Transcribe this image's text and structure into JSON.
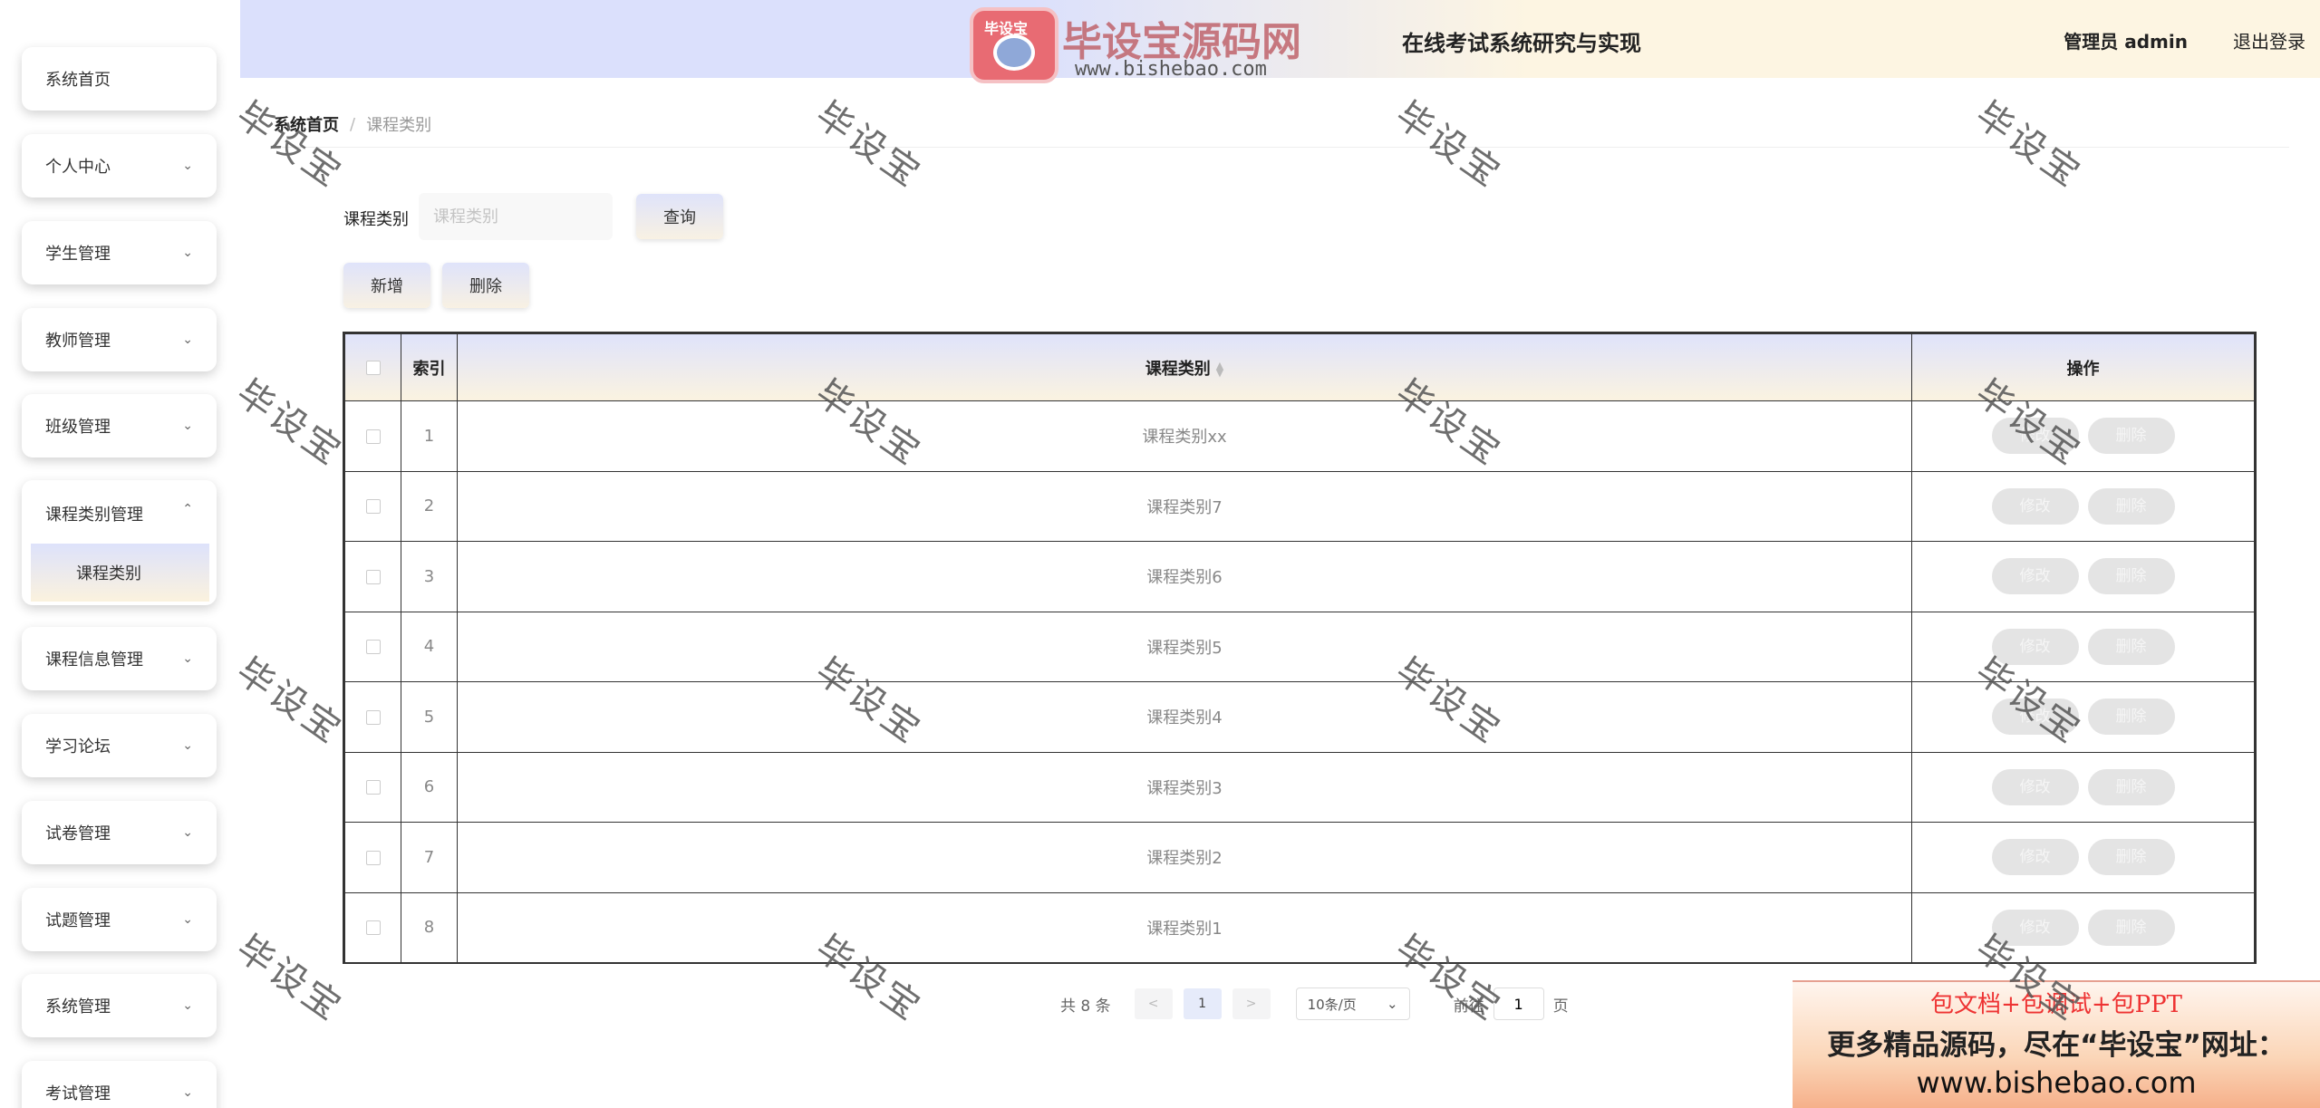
{
  "header": {
    "system_title": "在线考试系统研究与实现",
    "user_label": "管理员 admin",
    "logout_label": "退出登录",
    "logo_text": "毕设宝源码网",
    "logo_tag": "毕设宝",
    "logo_url": "www.bishebao.com"
  },
  "sidebar": {
    "items": [
      {
        "label": "系统首页"
      },
      {
        "label": "个人中心"
      },
      {
        "label": "学生管理"
      },
      {
        "label": "教师管理"
      },
      {
        "label": "班级管理"
      },
      {
        "label": "课程类别管理",
        "sub": "课程类别"
      },
      {
        "label": "课程信息管理"
      },
      {
        "label": "学习论坛"
      },
      {
        "label": "试卷管理"
      },
      {
        "label": "试题管理"
      },
      {
        "label": "系统管理"
      },
      {
        "label": "考试管理"
      }
    ]
  },
  "breadcrumb": {
    "home": "系统首页",
    "separator": "/",
    "current": "课程类别"
  },
  "search": {
    "label": "课程类别",
    "placeholder": "课程类别",
    "query_label": "查询"
  },
  "actions": {
    "add_label": "新增",
    "delete_label": "删除"
  },
  "table": {
    "headers": {
      "index": "索引",
      "category": "课程类别",
      "ops": "操作"
    },
    "edit_label": "修改",
    "delete_label": "删除",
    "rows": [
      {
        "index": "1",
        "category": "课程类别xx"
      },
      {
        "index": "2",
        "category": "课程类别7"
      },
      {
        "index": "3",
        "category": "课程类别6"
      },
      {
        "index": "4",
        "category": "课程类别5"
      },
      {
        "index": "5",
        "category": "课程类别4"
      },
      {
        "index": "6",
        "category": "课程类别3"
      },
      {
        "index": "7",
        "category": "课程类别2"
      },
      {
        "index": "8",
        "category": "课程类别1"
      }
    ]
  },
  "pagination": {
    "total": "共 8 条",
    "prev": "<",
    "current_page": "1",
    "next": ">",
    "page_size": "10条/页",
    "goto_prefix": "前往",
    "goto_value": "1",
    "goto_suffix": "页"
  },
  "promo": {
    "line1": "包文档+包调试+包PPT",
    "line2": "更多精品源码，尽在“毕设宝”网址：",
    "line3": "www.bishebao.com"
  },
  "watermark": "毕设宝"
}
